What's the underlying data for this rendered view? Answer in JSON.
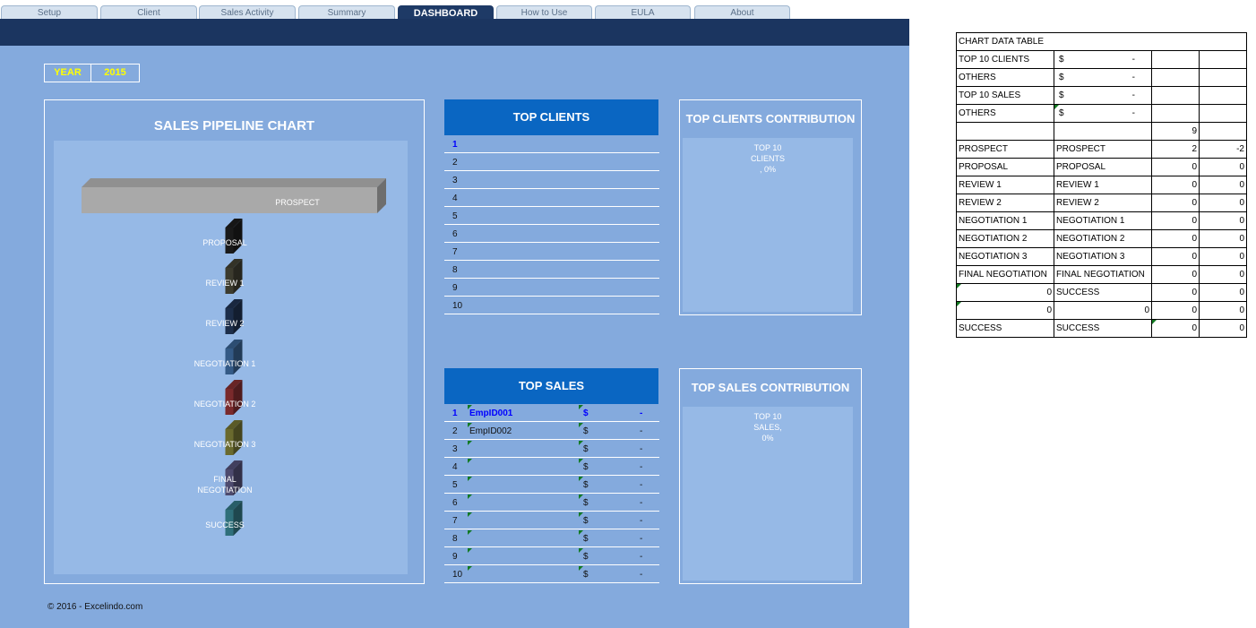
{
  "tabs": [
    {
      "label": "Setup",
      "active": false
    },
    {
      "label": "Client",
      "active": false
    },
    {
      "label": "Sales Activity",
      "active": false
    },
    {
      "label": "Summary",
      "active": false
    },
    {
      "label": "DASHBOARD",
      "active": true
    },
    {
      "label": "How to Use",
      "active": false
    },
    {
      "label": "EULA",
      "active": false
    },
    {
      "label": "About",
      "active": false
    }
  ],
  "year": {
    "label": "YEAR",
    "value": "2015"
  },
  "pipeline": {
    "title": "SALES PIPELINE CHART",
    "stages": [
      {
        "label": "PROSPECT",
        "value": 2,
        "color": "#a9a9a9"
      },
      {
        "label": "PROPOSAL",
        "value": 0,
        "color": "#1a1a1a"
      },
      {
        "label": "REVIEW 1",
        "value": 0,
        "color": "#3c3b2e"
      },
      {
        "label": "REVIEW 2",
        "value": 0,
        "color": "#1d2e4a"
      },
      {
        "label": "NEGOTIATION 1",
        "value": 0,
        "color": "#345a86"
      },
      {
        "label": "NEGOTIATION 2",
        "value": 0,
        "color": "#7a2a2c"
      },
      {
        "label": "NEGOTIATION 3",
        "value": 0,
        "color": "#6a6a2e"
      },
      {
        "label": "FINAL NEGOTIATION",
        "value": 0,
        "color": "#4d4a6e"
      },
      {
        "label": "SUCCESS",
        "value": 0,
        "color": "#2f6f7a"
      }
    ]
  },
  "top_clients": {
    "title": "TOP CLIENTS",
    "rows": [
      "1",
      "2",
      "3",
      "4",
      "5",
      "6",
      "7",
      "8",
      "9",
      "10"
    ]
  },
  "top_sales": {
    "title": "TOP SALES",
    "rows": [
      {
        "num": "1",
        "name": "EmpID001",
        "currency": "$",
        "amount": "-"
      },
      {
        "num": "2",
        "name": "EmpID002",
        "currency": "$",
        "amount": "-"
      },
      {
        "num": "3",
        "name": "",
        "currency": "$",
        "amount": "-"
      },
      {
        "num": "4",
        "name": "",
        "currency": "$",
        "amount": "-"
      },
      {
        "num": "5",
        "name": "",
        "currency": "$",
        "amount": "-"
      },
      {
        "num": "6",
        "name": "",
        "currency": "$",
        "amount": "-"
      },
      {
        "num": "7",
        "name": "",
        "currency": "$",
        "amount": "-"
      },
      {
        "num": "8",
        "name": "",
        "currency": "$",
        "amount": "-"
      },
      {
        "num": "9",
        "name": "",
        "currency": "$",
        "amount": "-"
      },
      {
        "num": "10",
        "name": "",
        "currency": "$",
        "amount": "-"
      }
    ]
  },
  "clients_contribution": {
    "title": "TOP CLIENTS CONTRIBUTION",
    "lines": [
      "TOP 10",
      "CLIENTS",
      ", 0%"
    ]
  },
  "sales_contribution": {
    "title": "TOP SALES CONTRIBUTION",
    "lines": [
      "TOP 10",
      "SALES,",
      "0%"
    ]
  },
  "copyright": "© 2016 - Excelindo.com",
  "data_table": {
    "title": "CHART DATA TABLE",
    "money_rows": [
      {
        "label": "TOP 10 CLIENTS",
        "currency": "$",
        "amount": "-"
      },
      {
        "label": "OTHERS",
        "currency": "$",
        "amount": "-"
      },
      {
        "label": "TOP 10 SALES",
        "currency": "$",
        "amount": "-"
      },
      {
        "label": "OTHERS",
        "currency": "$",
        "amount": "-"
      }
    ],
    "count_row": {
      "c3": "9"
    },
    "stage_rows": [
      {
        "c1": "PROSPECT",
        "c2": "PROSPECT",
        "c3": "2",
        "c4": "-2"
      },
      {
        "c1": "PROPOSAL",
        "c2": "PROPOSAL",
        "c3": "0",
        "c4": "0"
      },
      {
        "c1": "REVIEW 1",
        "c2": "REVIEW 1",
        "c3": "0",
        "c4": "0"
      },
      {
        "c1": "REVIEW 2",
        "c2": "REVIEW 2",
        "c3": "0",
        "c4": "0"
      },
      {
        "c1": "NEGOTIATION 1",
        "c2": "NEGOTIATION 1",
        "c3": "0",
        "c4": "0"
      },
      {
        "c1": "NEGOTIATION 2",
        "c2": "NEGOTIATION 2",
        "c3": "0",
        "c4": "0"
      },
      {
        "c1": "NEGOTIATION 3",
        "c2": "NEGOTIATION 3",
        "c3": "0",
        "c4": "0"
      },
      {
        "c1": "FINAL NEGOTIATION",
        "c2": "FINAL NEGOTIATION",
        "c3": "0",
        "c4": "0"
      },
      {
        "c1": "0",
        "c2": "SUCCESS",
        "c3": "0",
        "c4": "0"
      },
      {
        "c1": "0",
        "c2": "0",
        "c3": "0",
        "c4": "0"
      },
      {
        "c1": "SUCCESS",
        "c2": "SUCCESS",
        "c3": "0",
        "c4": "0"
      }
    ]
  },
  "colors": {
    "navy": "#1b3560",
    "panel_bg": "#84aadd",
    "header_blue": "#0a66c2",
    "year_text": "#ffff00"
  }
}
